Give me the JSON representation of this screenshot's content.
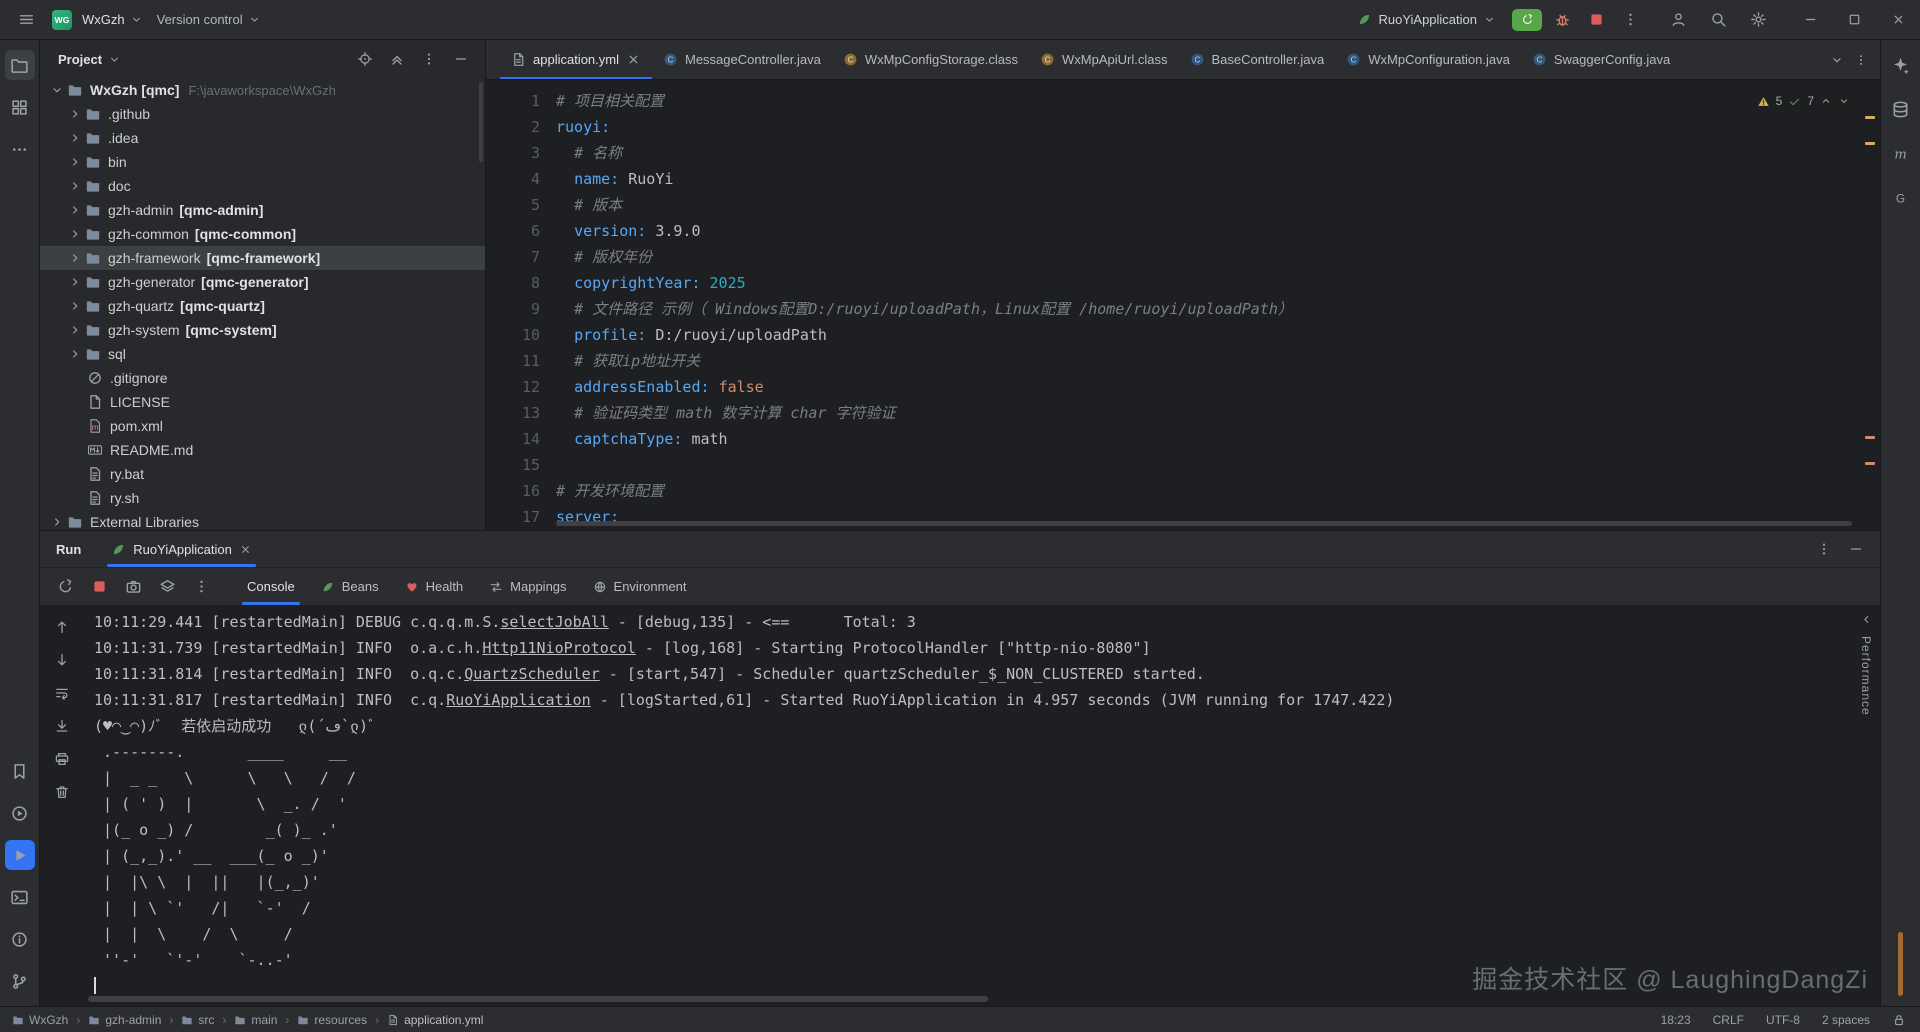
{
  "title_bar": {
    "project_badge": "WG",
    "project_switcher": "WxGzh",
    "vcs_menu": "Version control",
    "run_config": "RuoYiApplication",
    "right_action_icons": [
      {
        "n": "user-profile",
        "i": "user"
      },
      {
        "n": "search-everywhere",
        "i": "search"
      },
      {
        "n": "settings",
        "i": "settings"
      }
    ],
    "window_controls": [
      {
        "n": "minimize-button",
        "i": "minimize"
      },
      {
        "n": "maximize-button",
        "i": "maximize"
      },
      {
        "n": "close-button",
        "i": "close"
      }
    ]
  },
  "editor_tabs": [
    {
      "label": "application.yml",
      "icon": "yaml",
      "active": true
    },
    {
      "label": "MessageController.java",
      "icon": "class-blue"
    },
    {
      "label": "WxMpConfigStorage.class",
      "icon": "class-orange"
    },
    {
      "label": "WxMpApiUrl.class",
      "icon": "class-orange"
    },
    {
      "label": "BaseController.java",
      "icon": "class-blue"
    },
    {
      "label": "WxMpConfiguration.java",
      "icon": "class-blue"
    },
    {
      "label": "SwaggerConfig.java",
      "icon": "class-blue"
    }
  ],
  "project_panel": {
    "title": "Project",
    "header_icons": [
      {
        "n": "locate-file",
        "i": "target"
      },
      {
        "n": "collapse-all",
        "i": "collapse"
      },
      {
        "n": "panel-options",
        "i": "kebab"
      },
      {
        "n": "hide-panel",
        "i": "minimize"
      }
    ],
    "tree": [
      {
        "label": "WxGzh [qmc]",
        "sub": "F:\\javaworkspace\\WxGzh",
        "icon": "folder",
        "indent": 0,
        "chev": "down",
        "bold": true
      },
      {
        "label": ".github",
        "icon": "folder",
        "indent": 1,
        "chev": "right"
      },
      {
        "label": ".idea",
        "icon": "folder",
        "indent": 1,
        "chev": "right"
      },
      {
        "label": "bin",
        "icon": "folder",
        "indent": 1,
        "chev": "right"
      },
      {
        "label": "doc",
        "icon": "folder",
        "indent": 1,
        "chev": "right"
      },
      {
        "label": "gzh-admin",
        "tag": "[qmc-admin]",
        "icon": "folder",
        "indent": 1,
        "chev": "right"
      },
      {
        "label": "gzh-common",
        "tag": "[qmc-common]",
        "icon": "folder",
        "indent": 1,
        "chev": "right"
      },
      {
        "label": "gzh-framework",
        "tag": "[qmc-framework]",
        "icon": "folder",
        "indent": 1,
        "chev": "right",
        "selected": true
      },
      {
        "label": "gzh-generator",
        "tag": "[qmc-generator]",
        "icon": "folder",
        "indent": 1,
        "chev": "right"
      },
      {
        "label": "gzh-quartz",
        "tag": "[qmc-quartz]",
        "icon": "folder",
        "indent": 1,
        "chev": "right"
      },
      {
        "label": "gzh-system",
        "tag": "[qmc-system]",
        "icon": "folder",
        "indent": 1,
        "chev": "right"
      },
      {
        "label": "sql",
        "icon": "folder",
        "indent": 1,
        "chev": "right"
      },
      {
        "label": ".gitignore",
        "icon": "ignored",
        "indent": 1
      },
      {
        "label": "LICENSE",
        "icon": "file",
        "indent": 1
      },
      {
        "label": "pom.xml",
        "icon": "maven",
        "indent": 1
      },
      {
        "label": "README.md",
        "icon": "markdown",
        "indent": 1
      },
      {
        "label": "ry.bat",
        "icon": "text-file",
        "indent": 1
      },
      {
        "label": "ry.sh",
        "icon": "text-file",
        "indent": 1
      },
      {
        "label": "External Libraries",
        "icon": "folder",
        "indent": 0,
        "chev": "right"
      }
    ]
  },
  "editor": {
    "inspections": {
      "warnings": "5",
      "passed": "7"
    },
    "lines": [
      {
        "n": "1",
        "s": [
          [
            "cm",
            "# 项目相关配置"
          ]
        ]
      },
      {
        "n": "2",
        "s": [
          [
            "k",
            "ruoyi:"
          ]
        ]
      },
      {
        "n": "3",
        "s": [
          [
            "t",
            "  "
          ],
          [
            "cm",
            "# 名称"
          ]
        ]
      },
      {
        "n": "4",
        "s": [
          [
            "t",
            "  "
          ],
          [
            "k",
            "name:"
          ],
          [
            "t",
            " "
          ],
          [
            "v",
            "RuoYi"
          ]
        ]
      },
      {
        "n": "5",
        "s": [
          [
            "t",
            "  "
          ],
          [
            "cm",
            "# 版本"
          ]
        ]
      },
      {
        "n": "6",
        "s": [
          [
            "t",
            "  "
          ],
          [
            "k",
            "version:"
          ],
          [
            "t",
            " "
          ],
          [
            "v",
            "3.9.0"
          ]
        ]
      },
      {
        "n": "7",
        "s": [
          [
            "t",
            "  "
          ],
          [
            "cm",
            "# 版权年份"
          ]
        ]
      },
      {
        "n": "8",
        "s": [
          [
            "t",
            "  "
          ],
          [
            "k",
            "copyrightYear:"
          ],
          [
            "t",
            " "
          ],
          [
            "num",
            "2025"
          ]
        ]
      },
      {
        "n": "9",
        "s": [
          [
            "t",
            "  "
          ],
          [
            "cm",
            "# 文件路径 示例（ Windows配置D:/ruoyi/uploadPath，Linux配置 /home/ruoyi/uploadPath）"
          ]
        ]
      },
      {
        "n": "10",
        "s": [
          [
            "t",
            "  "
          ],
          [
            "k",
            "profile:"
          ],
          [
            "t",
            " "
          ],
          [
            "v",
            "D:/ruoyi/uploadPath"
          ]
        ]
      },
      {
        "n": "11",
        "s": [
          [
            "t",
            "  "
          ],
          [
            "cm",
            "# 获取ip地址开关"
          ]
        ]
      },
      {
        "n": "12",
        "s": [
          [
            "t",
            "  "
          ],
          [
            "k",
            "addressEnabled:"
          ],
          [
            "t",
            " "
          ],
          [
            "kw",
            "false"
          ]
        ]
      },
      {
        "n": "13",
        "s": [
          [
            "t",
            "  "
          ],
          [
            "cm",
            "# 验证码类型 math 数字计算 char 字符验证"
          ]
        ]
      },
      {
        "n": "14",
        "s": [
          [
            "t",
            "  "
          ],
          [
            "k",
            "captchaType:"
          ],
          [
            "t",
            " "
          ],
          [
            "v",
            "math"
          ]
        ]
      },
      {
        "n": "15",
        "s": []
      },
      {
        "n": "16",
        "s": [
          [
            "cm",
            "# 开发环境配置"
          ]
        ]
      },
      {
        "n": "17",
        "s": [
          [
            "k",
            "server:"
          ]
        ]
      }
    ]
  },
  "run_panel": {
    "title": "Run",
    "tab_label": "RuoYiApplication",
    "header_icons": [
      {
        "n": "panel-options",
        "i": "kebab"
      },
      {
        "n": "hide-panel",
        "i": "minimize"
      }
    ],
    "toolbar_icons": [
      {
        "n": "rerun",
        "i": "rerun",
        "c": "#7cab72"
      },
      {
        "n": "stop",
        "i": "stop-red"
      },
      {
        "n": "thread-dump",
        "i": "camera"
      },
      {
        "n": "layers",
        "i": "layers"
      },
      {
        "n": "toolbar-more",
        "i": "kebab"
      }
    ],
    "tabs": [
      {
        "label": "Console",
        "active": true
      },
      {
        "label": "Beans",
        "icon": "leaf"
      },
      {
        "label": "Health",
        "icon": "heart"
      },
      {
        "label": "Mappings",
        "icon": "mappings"
      },
      {
        "label": "Environment",
        "icon": "env"
      }
    ],
    "side_icons": [
      {
        "n": "prev-occurrence",
        "i": "arrow-up"
      },
      {
        "n": "next-occurrence",
        "i": "arrow-down"
      },
      {
        "n": "soft-wrap",
        "i": "soft-wrap"
      },
      {
        "n": "scroll-to-end",
        "i": "scroll-end"
      },
      {
        "n": "print",
        "i": "print"
      },
      {
        "n": "clear-all",
        "i": "trash"
      }
    ],
    "right_stub": "Performance",
    "console": [
      {
        "s": [
          [
            "p",
            "10:11:29.441 [restartedMain] DEBUG c.q.q.m.S."
          ],
          [
            "u",
            "selectJobAll"
          ],
          [
            "p",
            " - [debug,135] - <==      Total: 3"
          ]
        ]
      },
      {
        "s": [
          [
            "p",
            "10:11:31.739 [restartedMain] INFO  o.a.c.h."
          ],
          [
            "u",
            "Http11NioProtocol"
          ],
          [
            "p",
            " - [log,168] - Starting ProtocolHandler [\"http-nio-8080\"]"
          ]
        ]
      },
      {
        "s": [
          [
            "p",
            "10:11:31.814 [restartedMain] INFO  o.q.c."
          ],
          [
            "u",
            "QuartzScheduler"
          ],
          [
            "p",
            " - [start,547] - Scheduler quartzScheduler_$_NON_CLUSTERED started."
          ]
        ]
      },
      {
        "s": [
          [
            "p",
            "10:11:31.817 [restartedMain] INFO  c.q."
          ],
          [
            "u",
            "RuoYiApplication"
          ],
          [
            "p",
            " - [logStarted,61] - Started RuoYiApplication in 4.957 seconds (JVM running for 1747.422)"
          ]
        ]
      },
      {
        "s": [
          [
            "p",
            "(♥◠‿◠)ﾉﾞ  若依启动成功   ლ(´ڡ`ლ)ﾞ"
          ]
        ]
      },
      {
        "s": [
          [
            "p",
            " .-------.       ____     __"
          ]
        ]
      },
      {
        "s": [
          [
            "p",
            " |  _ _   \\      \\   \\   /  /"
          ]
        ]
      },
      {
        "s": [
          [
            "p",
            " | ( ' )  |       \\  _. /  '"
          ]
        ]
      },
      {
        "s": [
          [
            "p",
            " |(_ o _) /        _( )_ .'"
          ]
        ]
      },
      {
        "s": [
          [
            "p",
            " | (_,_).' __  ___(_ o _)'"
          ]
        ]
      },
      {
        "s": [
          [
            "p",
            " |  |\\ \\  |  ||   |(_,_)'"
          ]
        ]
      },
      {
        "s": [
          [
            "p",
            " |  | \\ `'   /|   `-'  /"
          ]
        ]
      },
      {
        "s": [
          [
            "p",
            " |  |  \\    /  \\     /"
          ]
        ]
      },
      {
        "s": [
          [
            "p",
            " ''-'   `'-'    `-..-'"
          ]
        ]
      },
      {
        "s": [],
        "caret": true
      }
    ]
  },
  "left_toolbar": {
    "top": [
      {
        "n": "tool-project",
        "i": "folder-o",
        "a": true
      },
      {
        "n": "tool-structure",
        "i": "structure"
      },
      {
        "n": "tool-more",
        "i": "dots-h"
      }
    ],
    "bottom": [
      {
        "n": "tool-bookmarks",
        "i": "bookmark"
      },
      {
        "n": "tool-services",
        "i": "play-circle"
      },
      {
        "n": "tool-run",
        "i": "play",
        "b": true
      },
      {
        "n": "tool-terminal",
        "i": "terminal"
      },
      {
        "n": "tool-problems",
        "i": "info"
      },
      {
        "n": "tool-version-control",
        "i": "branch"
      }
    ]
  },
  "right_toolbar": {
    "top": [
      {
        "n": "tool-ai-assistant",
        "i": "ai"
      },
      {
        "n": "tool-database",
        "i": "database"
      },
      {
        "n": "tool-maven",
        "i": "maven-m"
      },
      {
        "n": "tool-gradle",
        "i": "gradle"
      }
    ]
  },
  "status_bar": {
    "breadcrumbs": [
      {
        "label": "WxGzh",
        "icon": "folder"
      },
      {
        "label": "gzh-admin",
        "icon": "folder"
      },
      {
        "label": "src",
        "icon": "folder"
      },
      {
        "label": "main",
        "icon": "folder"
      },
      {
        "label": "resources",
        "icon": "folder"
      },
      {
        "label": "application.yml",
        "icon": "yaml"
      }
    ],
    "caret_position": "18:23",
    "line_separator": "CRLF",
    "encoding": "UTF-8",
    "indent": "2 spaces"
  },
  "watermark": "掘金技术社区 @ LaughingDangZi",
  "colors": {
    "accent": "#3574f0",
    "run_green": "#57a64a",
    "stop_red": "#db5c5c",
    "warning_yellow": "#d6ae58",
    "panel_bg": "#2b2d30",
    "editor_bg": "#1e1f22"
  }
}
